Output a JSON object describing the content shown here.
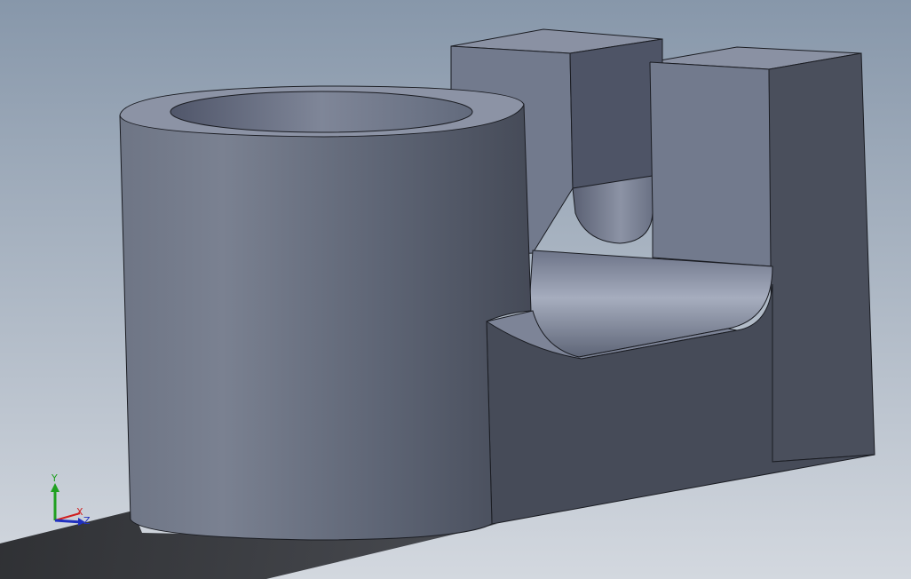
{
  "viewport": {
    "background_top": "#8797aa",
    "background_bottom": "#d3d8df",
    "model_color": "#6c7384",
    "edge_color": "#1a1c22"
  },
  "triad": {
    "x_label": "X",
    "y_label": "Y",
    "z_label": "Z",
    "x_color": "#d02020",
    "y_color": "#20a020",
    "z_color": "#2030c0"
  }
}
